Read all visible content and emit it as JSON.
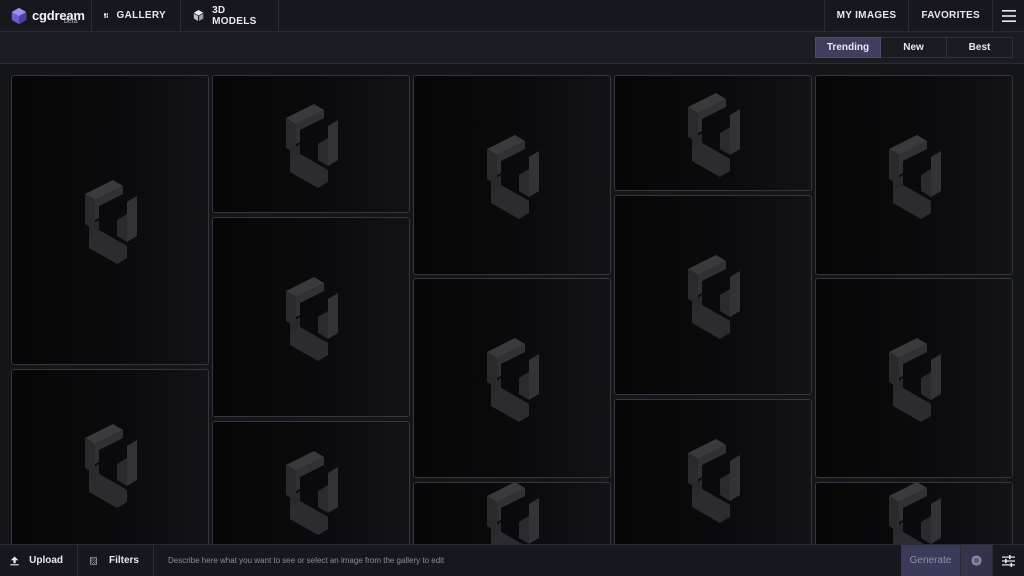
{
  "brand": {
    "name": "cgdream",
    "badge": "beta"
  },
  "nav": {
    "gallery_label": "GALLERY",
    "models_label": "3D MODELS",
    "my_images_label": "MY IMAGES",
    "favorites_label": "FAVORITES"
  },
  "sort": {
    "options": [
      "Trending",
      "New",
      "Best"
    ],
    "selected": "Trending"
  },
  "bottom": {
    "upload_label": "Upload",
    "filters_label": "Filters",
    "prompt_placeholder": "Describe here what you want to see or select an image from the gallery to edit",
    "prompt_value": "",
    "generate_label": "Generate"
  },
  "icons": {
    "brand": "cube-logo-icon",
    "gallery": "grid-icon",
    "models": "cube-icon",
    "menu": "hamburger-icon",
    "upload": "upload-icon",
    "filters": "stripes-icon",
    "credits": "coin-icon",
    "settings": "sliders-icon",
    "placeholder": "loading-logo-icon"
  },
  "colors": {
    "background": "#141519",
    "accent": "#3e3f5e",
    "generate": "#3a3b58"
  }
}
